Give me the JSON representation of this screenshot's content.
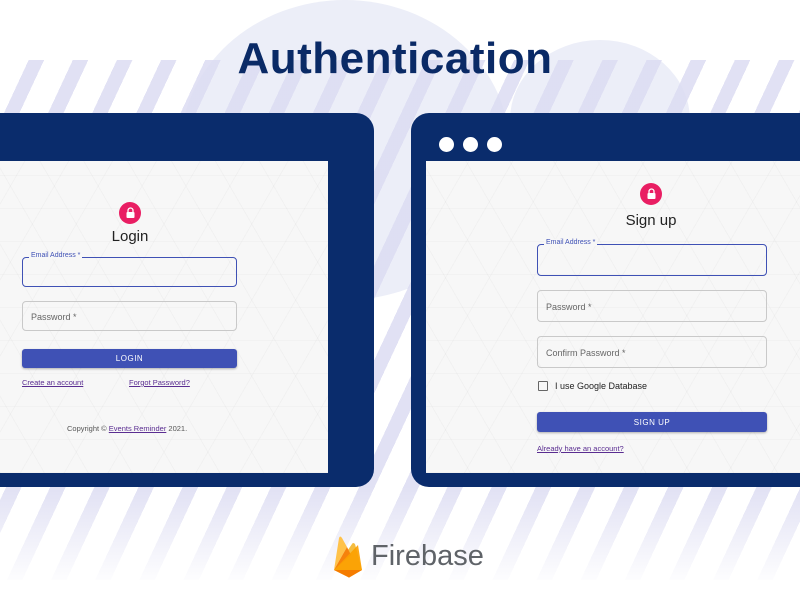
{
  "page": {
    "title": "Authentication"
  },
  "login": {
    "title": "Login",
    "email_label": "Email Address *",
    "password_label": "Password *",
    "button": "LOGIN",
    "create_account": "Create an account",
    "forgot_password": "Forgot Password?",
    "copyright_prefix": "Copyright © ",
    "copyright_link": "Events Reminder",
    "copyright_suffix": " 2021."
  },
  "signup": {
    "title": "Sign up",
    "email_label": "Email Address *",
    "password_label": "Password *",
    "confirm_label": "Confirm Password *",
    "checkbox_label": "I use Google Database",
    "checkbox_checked": false,
    "button": "SIGN UP",
    "already_account": "Already have an account?"
  },
  "brand": {
    "name": "Firebase"
  },
  "colors": {
    "navy": "#0a2c6c",
    "primary": "#3f51b5",
    "lock": "#e91e63",
    "link": "#5a2d91"
  },
  "icons": [
    "lock-icon",
    "window-dot",
    "firebase-flame-icon"
  ]
}
